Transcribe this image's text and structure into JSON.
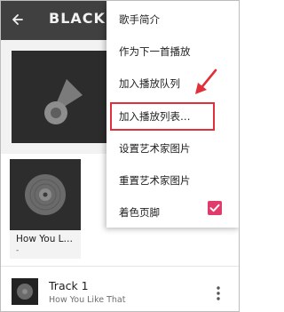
{
  "header": {
    "title": "BLACKPINK"
  },
  "album": {
    "title": "How You L…",
    "subtitle": "-"
  },
  "track": {
    "title": "Track 1",
    "artist": "How You Like That"
  },
  "menu": {
    "items": [
      {
        "label": "歌手简介"
      },
      {
        "label": "作为下一首播放"
      },
      {
        "label": "加入播放队列"
      },
      {
        "label": "加入播放列表…"
      },
      {
        "label": "设置艺术家图片"
      },
      {
        "label": "重置艺术家图片"
      },
      {
        "label": "着色页脚"
      }
    ],
    "checkbox_checked": true
  },
  "colors": {
    "accent": "#e23a6a",
    "annotation": "#e0303a"
  },
  "icons": [
    "back-arrow-icon",
    "music-note-icon",
    "disc-icon",
    "more-vert-icon",
    "check-icon",
    "annotation-arrow"
  ]
}
